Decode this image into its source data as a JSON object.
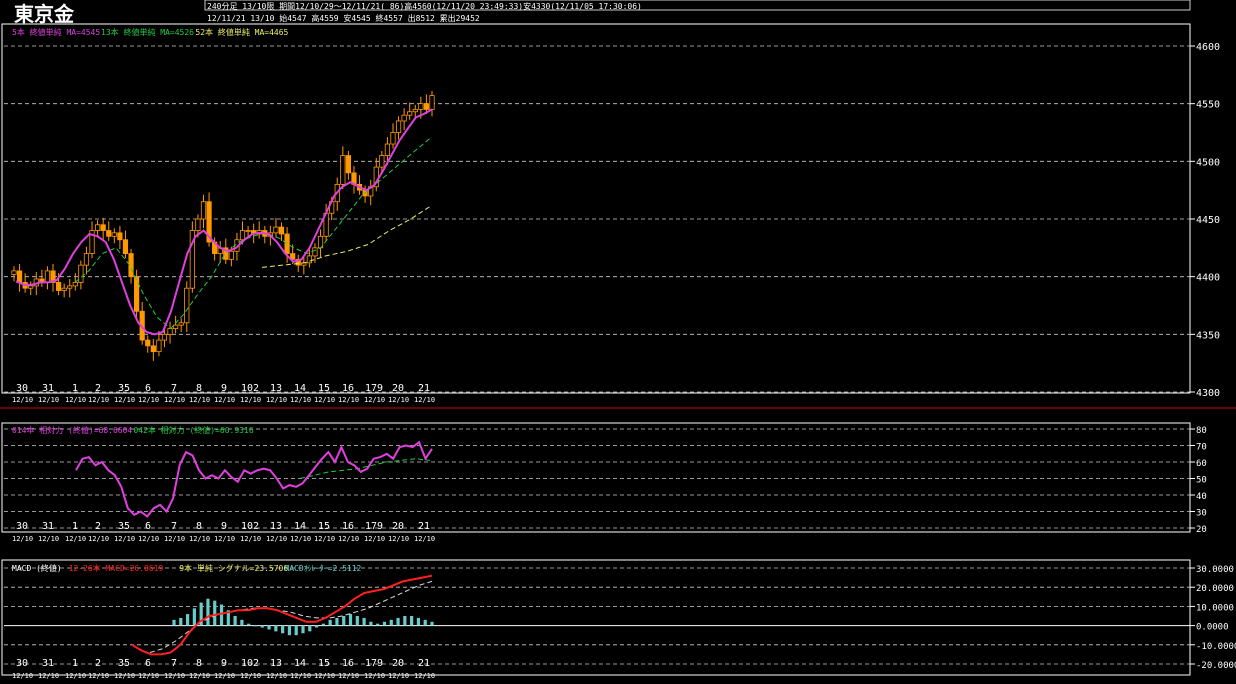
{
  "header": {
    "title": "東京金",
    "line1": "240分足  13/10限  期間12/10/29～12/11/21( 86)高4560(12/11/20 23:49:33)安4330(12/11/05 17:30:06)",
    "line2": "12/11/21 13/10 始4547 高4559 安4545 終4557 出8512 累出29452"
  },
  "colors": {
    "up_candle": "#ff9900",
    "down_candle": "#cc8800",
    "ma5": "#e040e0",
    "ma13": "#22cc44",
    "ma52": "#eeee66",
    "rsi14": "#e040e0",
    "rsi42": "#22cc44",
    "macd": "#ff2020",
    "signal": "#dddddd",
    "histogram": "#66cccc",
    "grid": "#cccccc",
    "divider": "#cc0000"
  },
  "x_labels": [
    "30",
    "31",
    "1",
    "2",
    "35",
    "6",
    "7",
    "8",
    "9",
    "102",
    "13",
    "14",
    "15",
    "16",
    "179",
    "20",
    "21"
  ],
  "x_sublabels": [
    "12/10",
    "12/10",
    "12/10",
    "12/10",
    "12/10",
    "12/10",
    "12/10",
    "12/10",
    "12/10",
    "12/10",
    "12/10",
    "12/10",
    "12/10",
    "12/10",
    "12/10",
    "12/10",
    "12/10"
  ],
  "chart_data": [
    {
      "type": "candlestick",
      "legend": [
        {
          "text": "5本 終値単純 MA=4545",
          "color": "#e040e0"
        },
        {
          "text": "13本 終値単純 MA=4526",
          "color": "#22cc44"
        },
        {
          "text": "52本 終値単純 MA=4465",
          "color": "#eeee66"
        }
      ],
      "ylim": [
        4300,
        4600
      ],
      "y_ticks": [
        "4600",
        "4550",
        "4500",
        "4450",
        "4400",
        "4350",
        "4300"
      ],
      "grid": true,
      "ohlc_close_path": [
        4405,
        4395,
        4390,
        4392,
        4398,
        4395,
        4405,
        4395,
        4388,
        4390,
        4392,
        4395,
        4410,
        4420,
        4440,
        4445,
        4440,
        4435,
        4438,
        4432,
        4420,
        4400,
        4370,
        4345,
        4340,
        4335,
        4345,
        4350,
        4355,
        4358,
        4360,
        4390,
        4440,
        4450,
        4465,
        4430,
        4420,
        4425,
        4415,
        4422,
        4432,
        4440,
        4440,
        4437,
        4440,
        4435,
        4438,
        4443,
        4437,
        4420,
        4415,
        4410,
        4412,
        4418,
        4425,
        4435,
        4455,
        4465,
        4480,
        4505,
        4490,
        4480,
        4475,
        4470,
        4478,
        4495,
        4505,
        4515,
        4525,
        4535,
        4540,
        4543,
        4545,
        4550,
        4545,
        4557
      ],
      "ma5": [
        4396,
        4393,
        4393,
        4395,
        4395,
        4397,
        4407,
        4420,
        4430,
        4437,
        4435,
        4430,
        4415,
        4395,
        4375,
        4360,
        4352,
        4350,
        4352,
        4370,
        4395,
        4420,
        4435,
        4440,
        4432,
        4425,
        4422,
        4425,
        4432,
        4437,
        4438,
        4437,
        4430,
        4420,
        4413,
        4415,
        4425,
        4440,
        4455,
        4470,
        4478,
        4482,
        4478,
        4475,
        4480,
        4492,
        4505,
        4518,
        4528,
        4538,
        4541,
        4545
      ],
      "ma13": [
        4395,
        4405,
        4420,
        4425,
        4410,
        4385,
        4365,
        4355,
        4368,
        4385,
        4400,
        4420,
        4430,
        4435,
        4438,
        4433,
        4425,
        4420,
        4425,
        4440,
        4455,
        4470,
        4480,
        4490,
        4500,
        4510,
        4520
      ],
      "ma52": [
        4408,
        4410,
        4412,
        4418,
        4422,
        4428,
        4440,
        4450,
        4462
      ]
    },
    {
      "type": "line",
      "legend": [
        {
          "text": "014本 相対力 (終値)=68.6604",
          "color": "#e040e0"
        },
        {
          "text": "042本 相対力 (終値)=60.9316",
          "color": "#22cc44"
        }
      ],
      "ylim": [
        20,
        80
      ],
      "y_ticks": [
        "80",
        "70",
        "60",
        "50",
        "40",
        "30",
        "20"
      ],
      "rsi14": [
        55,
        62,
        63,
        58,
        60,
        55,
        52,
        45,
        32,
        28,
        30,
        27,
        32,
        34,
        30,
        38,
        58,
        66,
        64,
        55,
        50,
        52,
        50,
        55,
        51,
        48,
        55,
        53,
        55,
        56,
        55,
        50,
        44,
        46,
        45,
        47,
        52,
        57,
        62,
        66,
        60,
        69,
        60,
        58,
        54,
        56,
        62,
        63,
        65,
        62,
        69,
        70,
        69,
        72,
        62,
        68
      ],
      "rsi42": [
        50,
        52,
        54,
        55,
        56,
        58,
        60,
        61,
        62,
        61
      ]
    },
    {
      "type": "bar+line",
      "legend": [
        {
          "text": "MACD (終値)",
          "color": "#ffffff"
        },
        {
          "text": "12-26本 MACD=26.0619",
          "color": "#ff2020"
        },
        {
          "text": "9本 単純 シグナル=23.5706",
          "color": "#eeee66"
        },
        {
          "text": "MACDｵｼﾚｰﾀｰ=2.5112",
          "color": "#66cccc"
        }
      ],
      "ylim": [
        -20,
        30
      ],
      "y_ticks": [
        "30.0000",
        "20.0000",
        "10.0000",
        "0.0000",
        "-10.0000",
        "-20.0000"
      ],
      "macd": [
        -10,
        -13,
        -15,
        -15,
        -14,
        -10,
        -3,
        2,
        5,
        6,
        7,
        8,
        8,
        9,
        9,
        8,
        6,
        4,
        2,
        2,
        4,
        7,
        10,
        14,
        17,
        18,
        19,
        21,
        23,
        24,
        25,
        26
      ],
      "signal": [
        -14,
        -12,
        -8,
        -3,
        2,
        5,
        7,
        8,
        9,
        9,
        8,
        7,
        5,
        4,
        4,
        5,
        7,
        9,
        12,
        15,
        18,
        21,
        23
      ],
      "histogram": [
        3,
        4,
        6,
        9,
        12,
        14,
        13,
        11,
        8,
        5,
        3,
        1,
        0,
        -1,
        -2,
        -3,
        -4,
        -5,
        -5,
        -4,
        -3,
        -1,
        1,
        3,
        4,
        5,
        6,
        5,
        4,
        2,
        1,
        2,
        3,
        4,
        5,
        5,
        4,
        3,
        2
      ]
    }
  ]
}
